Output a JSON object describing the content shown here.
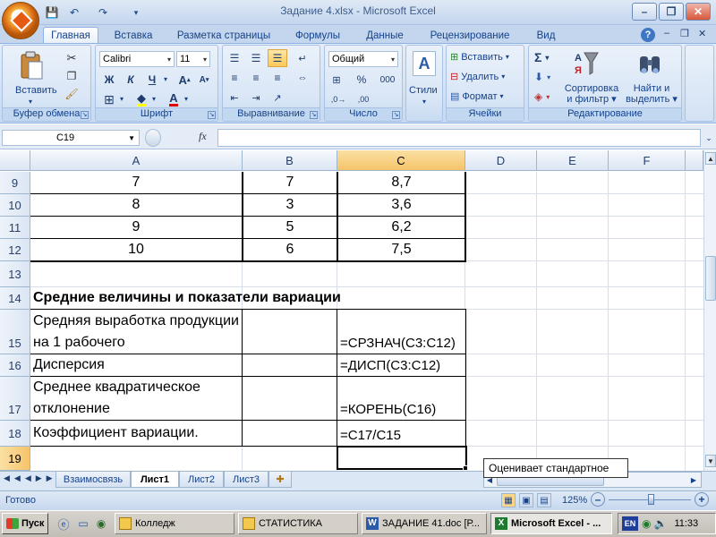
{
  "window": {
    "title": "Задание 4.xlsx - Microsoft Excel",
    "help": "?",
    "minimize": "–",
    "restore": "❐",
    "close": "✕"
  },
  "qat": {
    "undo": "↶",
    "redo": "↷",
    "save": "💾"
  },
  "tabs": [
    "Главная",
    "Вставка",
    "Разметка страницы",
    "Формулы",
    "Данные",
    "Рецензирование",
    "Вид"
  ],
  "ribbon": {
    "clipboard": {
      "label": "Буфер обмена",
      "paste": "Вставить"
    },
    "font": {
      "label": "Шрифт",
      "name": "Calibri",
      "size": "11",
      "bold": "Ж",
      "italic": "К",
      "underline": "Ч"
    },
    "alignment": {
      "label": "Выравнивание"
    },
    "number": {
      "label": "Число",
      "format": "Общий",
      "percent": "%",
      "thousands": "000",
      "currency": "⊞"
    },
    "styles": {
      "label": "Стили"
    },
    "cells": {
      "label": "Ячейки",
      "insert": "Вставить",
      "delete": "Удалить",
      "format": "Формат"
    },
    "editing": {
      "label": "Редактирование",
      "sum": "Σ",
      "sort": "Сортировка и фильтр",
      "sort_l1": "Сортировка",
      "sort_l2": "и фильтр",
      "find_l1": "Найти и",
      "find_l2": "выделить"
    }
  },
  "formula_bar": {
    "name_box": "C19",
    "fx": "fx",
    "value": ""
  },
  "columns": [
    "A",
    "B",
    "C",
    "D",
    "E",
    "F"
  ],
  "rows": [
    "9",
    "10",
    "11",
    "12",
    "13",
    "14",
    "15",
    "16",
    "17",
    "18",
    "19"
  ],
  "cells": {
    "a9": "7",
    "b9": "7",
    "c9": "8,7",
    "a10": "8",
    "b10": "3",
    "c10": "3,6",
    "a11": "9",
    "b11": "5",
    "c11": "6,2",
    "a12": "10",
    "b12": "6",
    "c12": "7,5",
    "a14": "Средние величины и показатели вариации",
    "a15": "Средняя выработка продукции на 1 рабочего",
    "c15": "=СРЗНАЧ(C3:C12)",
    "a16": "Дисперсия",
    "c16": "=ДИСП(C3:C12)",
    "a17": "Среднее квадратическое отклонение",
    "c17": "=КОРЕНЬ(C16)",
    "a18": "Коэффициент вариации.",
    "c18": "=C17/C15"
  },
  "tooltip": "Оценивает стандартное",
  "sheets": [
    "Взаимосвязь",
    "Лист1",
    "Лист2",
    "Лист3"
  ],
  "status": {
    "ready": "Готово",
    "zoom": "125%"
  },
  "taskbar": {
    "start": "Пуск",
    "items": [
      "Колледж",
      "СТАТИСТИКА",
      "ЗАДАНИЕ 41.doc [Р...",
      "Microsoft Excel - ..."
    ],
    "lang": "EN",
    "clock": "11:33"
  }
}
